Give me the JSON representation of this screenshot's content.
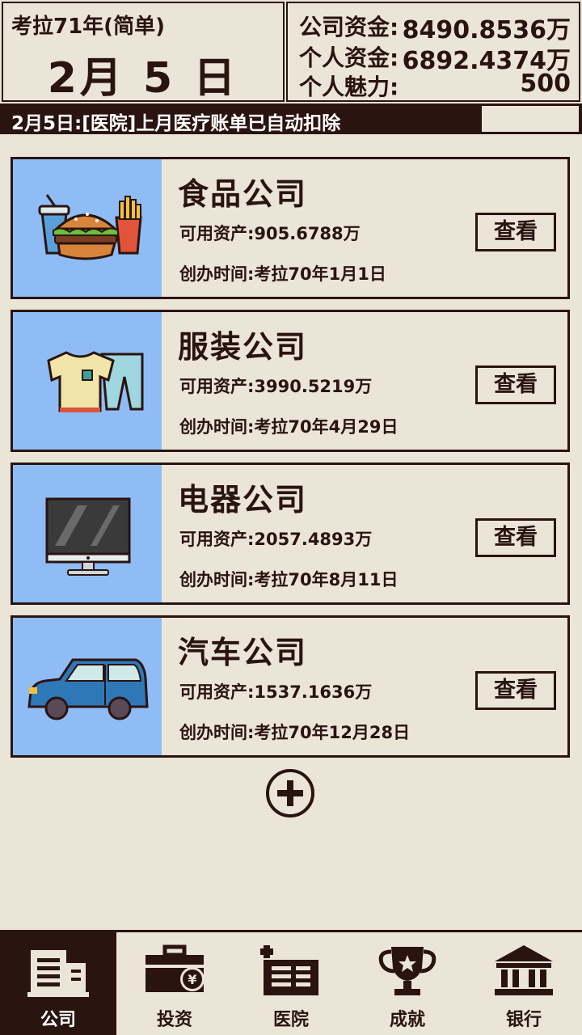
{
  "header": {
    "year_label": "考拉71年(简单)",
    "date": "2月 5 日",
    "stats": [
      {
        "label": "公司资金:",
        "value": "8490.8536万"
      },
      {
        "label": "个人资金:",
        "value": "6892.4374万"
      },
      {
        "label": "个人魅力:",
        "value": "500"
      }
    ]
  },
  "ticker": {
    "message": "2月5日:[医院]上月医疗账单已自动扣除"
  },
  "companies": [
    {
      "name": "食品公司",
      "assets": "可用资产:905.6788万",
      "founded": "创办时间:考拉70年1月1日",
      "action": "查看",
      "icon": "burger-fries-icon"
    },
    {
      "name": "服装公司",
      "assets": "可用资产:3990.5219万",
      "founded": "创办时间:考拉70年4月29日",
      "action": "查看",
      "icon": "clothes-icon"
    },
    {
      "name": "电器公司",
      "assets": "可用资产:2057.4893万",
      "founded": "创办时间:考拉70年8月11日",
      "action": "查看",
      "icon": "monitor-icon"
    },
    {
      "name": "汽车公司",
      "assets": "可用资产:1537.1636万",
      "founded": "创办时间:考拉70年12月28日",
      "action": "查看",
      "icon": "car-icon"
    }
  ],
  "add_button_icon": "plus-circle-icon",
  "nav": [
    {
      "label": "公司",
      "icon": "building-icon",
      "active": true
    },
    {
      "label": "投资",
      "icon": "briefcase-yen-icon",
      "active": false
    },
    {
      "label": "医院",
      "icon": "hospital-icon",
      "active": false
    },
    {
      "label": "成就",
      "icon": "trophy-icon",
      "active": false
    },
    {
      "label": "银行",
      "icon": "bank-icon",
      "active": false
    }
  ],
  "colors": {
    "dark": "#2a1410",
    "background": "#ebe5d8",
    "card_image_bg": "#8fbcf4"
  }
}
